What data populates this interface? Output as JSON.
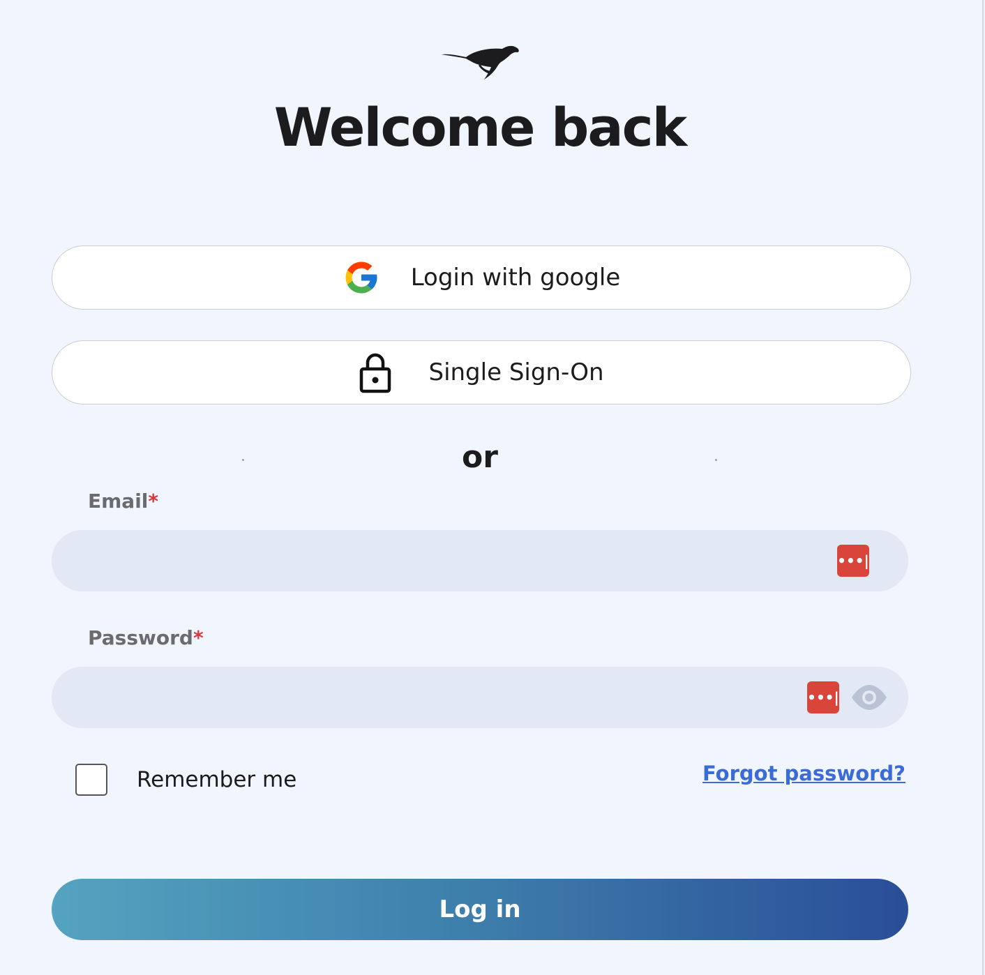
{
  "brand": {
    "logo_icon": "cheetah-logo-icon"
  },
  "header": {
    "title": "Welcome back"
  },
  "oauth": {
    "google_label": "Login with google",
    "google_icon": "google-icon",
    "sso_label": "Single Sign-On",
    "sso_icon": "lock-icon"
  },
  "divider": {
    "text": "or"
  },
  "form": {
    "email": {
      "label": "Email",
      "required_mark": "*",
      "value": "",
      "placeholder": ""
    },
    "password": {
      "label": "Password",
      "required_mark": "*",
      "value": "",
      "placeholder": ""
    },
    "password_manager_icon": "password-manager-icon",
    "password_manager_glyph": "•••|",
    "show_password_icon": "eye-icon",
    "remember_me": {
      "label": "Remember me",
      "checked": false
    },
    "forgot_password_label": "Forgot password?",
    "submit_label": "Log in"
  },
  "colors": {
    "background": "#f1f5fd",
    "input_bg": "#e2e8f4",
    "required": "#d9363e",
    "link": "#3a6bd6",
    "password_manager": "#d9453a",
    "button_gradient_start": "#54a3c0",
    "button_gradient_end": "#2a4e98"
  }
}
